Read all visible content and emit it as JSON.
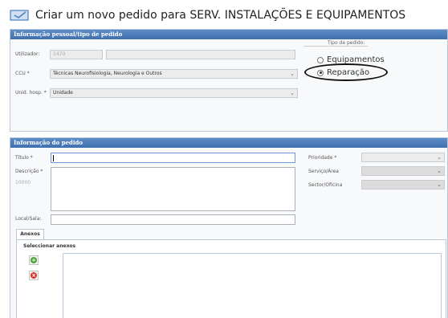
{
  "header": {
    "title": "Criar um novo pedido para SERV. INSTALAÇÕES E EQUIPAMENTOS",
    "icon": "edit-form-icon"
  },
  "personal": {
    "title": "Informação pessoal/tipo de pedido",
    "user_label": "Utilizador:",
    "user_value": "1470",
    "ccu_label": "CCU *",
    "ccu_value": "Técnicas Neurofisiologia, Neurologia e Outros",
    "unit_label": "Unid. hosp. *",
    "unit_value": "Unidade",
    "type_title": "Tipo de pedido:",
    "type_options": [
      "Equipamentos",
      "Reparação"
    ],
    "type_selected": "Reparação"
  },
  "order": {
    "title": "Informação do pedido",
    "title_label": "Título *",
    "title_value": "",
    "description_label": "Descrição *",
    "description_counter": "10000",
    "location_label": "Local/Sala:",
    "priority_label": "Prioridade *",
    "service_label": "Serviço/Área",
    "sector_label": "Sector/Oficina"
  },
  "attachments": {
    "tab_label": "Anexos",
    "select_label": "Seleccionar anexos",
    "add_icon": "add-icon",
    "remove_icon": "remove-icon"
  },
  "colors": {
    "panel_header": "#4a7bbd",
    "add": "#4aa33a",
    "remove": "#d9342b"
  }
}
